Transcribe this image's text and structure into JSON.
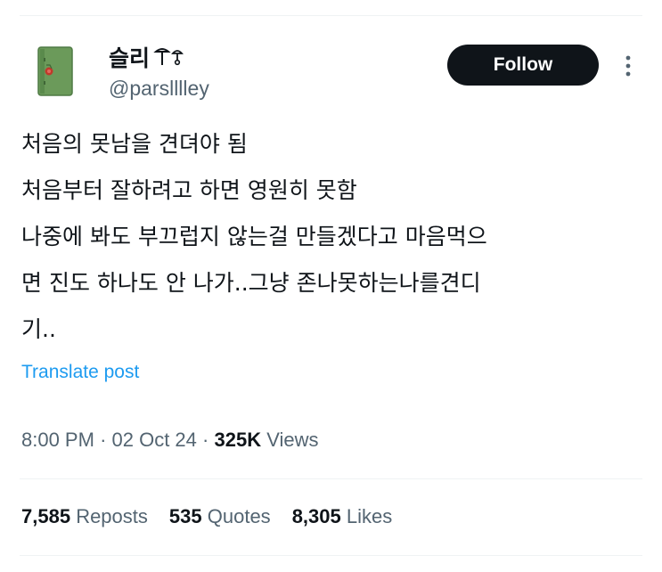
{
  "author": {
    "display_name": "슬리",
    "handle": "@parslllley"
  },
  "follow_label": "Follow",
  "tweet": {
    "lines": [
      "처음의 못남을 견뎌야 됨",
      "처음부터 잘하려고 하면 영원히 못함",
      "나중에 봐도 부끄럽지 않는걸 만들겠다고 마음먹으",
      "면 진도 하나도 안 나가..그냥 존나못하는나를견디",
      "기.."
    ]
  },
  "translate_label": "Translate post",
  "meta": {
    "time": "8:00 PM",
    "date": "02 Oct 24",
    "views_count": "325K",
    "views_label": "Views"
  },
  "stats": {
    "reposts_count": "7,585",
    "reposts_label": "Reposts",
    "quotes_count": "535",
    "quotes_label": "Quotes",
    "likes_count": "8,305",
    "likes_label": "Likes"
  },
  "colors": {
    "accent": "#1d9bf0",
    "text": "#0f1419",
    "secondary": "#536471",
    "button_bg": "#0f1419"
  },
  "icons": {
    "avatar": "green-notebook-avatar",
    "name_emoji": "mushroom-icon",
    "more": "more-icon"
  }
}
